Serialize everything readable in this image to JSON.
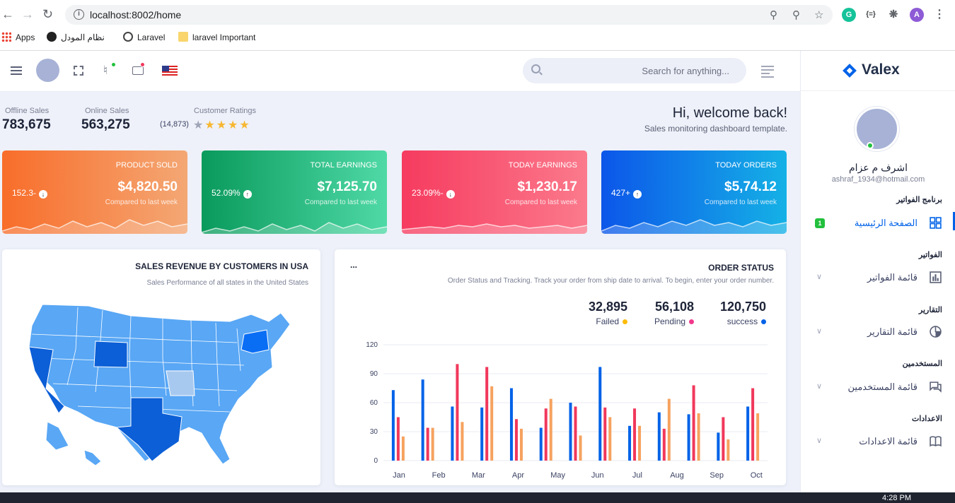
{
  "browser": {
    "url": "localhost:8002/home",
    "profile_initial": "A",
    "bookmarks": [
      {
        "label": "Apps"
      },
      {
        "label": "نظام المودل"
      },
      {
        "label": "Laravel"
      },
      {
        "label": "laravel Important"
      }
    ]
  },
  "header": {
    "search_placeholder": "Search for anything..."
  },
  "stats": {
    "offline_label": "Offline Sales",
    "offline_value": "783,675",
    "online_label": "Online Sales",
    "online_value": "563,275",
    "ratings_label": "Customer Ratings",
    "ratings_count": "(14,873)",
    "ratings_stars": 4.5
  },
  "welcome": {
    "title": "Hi, welcome back!",
    "subtitle": "Sales monitoring dashboard template."
  },
  "cards": [
    {
      "title": "PRODUCT SOLD",
      "amount": "$4,820.50",
      "compare": "Compared to last week",
      "percent": "152.3-",
      "trend": "down",
      "color_from": "#f86d2a",
      "color_to": "#f4a774"
    },
    {
      "title": "TOTAL EARNINGS",
      "amount": "$7,125.70",
      "compare": "Compared to last week",
      "percent": "52.09%",
      "trend": "up",
      "color_from": "#0a9a5c",
      "color_to": "#4fd9a6"
    },
    {
      "title": "TODAY EARNINGS",
      "amount": "$1,230.17",
      "compare": "Compared to last week",
      "percent": "23.09%-",
      "trend": "down",
      "color_from": "#f63b5f",
      "color_to": "#fb7a8c"
    },
    {
      "title": "TODAY ORDERS",
      "amount": "$5,74.12",
      "compare": "Compared to last week",
      "percent": "427+",
      "trend": "up",
      "color_from": "#0c56e9",
      "color_to": "#15b1e6"
    }
  ],
  "map_panel": {
    "title": "SALES REVENUE BY CUSTOMERS IN USA",
    "subtitle": "Sales Performance of all states in the United States"
  },
  "order_panel": {
    "title": "ORDER STATUS",
    "menu": "...",
    "subtitle": "Order Status and Tracking. Track your order from ship date to arrival. To begin, enter your order number.",
    "totals": [
      {
        "value": "32,895",
        "label": "Failed",
        "color": "#fbbc0b"
      },
      {
        "value": "56,108",
        "label": "Pending",
        "color": "#f1388b"
      },
      {
        "value": "120,750",
        "label": "success",
        "color": "#0162e8"
      }
    ]
  },
  "chart_data": {
    "type": "bar",
    "categories": [
      "Jan",
      "Feb",
      "Mar",
      "Apr",
      "May",
      "Jun",
      "Jul",
      "Aug",
      "Sep",
      "Oct"
    ],
    "series": [
      {
        "values": [
          73,
          84,
          56,
          55,
          75,
          34,
          60,
          97,
          36,
          50,
          48,
          29,
          56
        ],
        "color": "#0162e8"
      },
      {
        "values": [
          45,
          34,
          100,
          97,
          43,
          54,
          56,
          55,
          54,
          33,
          78,
          45,
          75
        ],
        "color": "#f1385c"
      },
      {
        "values": [
          25,
          34,
          40,
          77,
          33,
          64,
          26,
          45,
          36,
          64,
          49,
          22,
          49
        ],
        "color": "#f6a25f"
      }
    ],
    "yticks": [
      0,
      30,
      60,
      90,
      120
    ],
    "ylim": [
      0,
      120
    ]
  },
  "sidebar": {
    "brand": "Valex",
    "user_name": "اشرف م عزام",
    "user_email": "ashraf_1934@hotmail.com",
    "sections": [
      {
        "category": "برنامج الفواتير",
        "item": "الصفحة الرئيسية",
        "badge": "1",
        "active": true
      },
      {
        "category": "الفواتير",
        "item": "قائمة الفواتير"
      },
      {
        "category": "التقارير",
        "item": "قائمة التقارير"
      },
      {
        "category": "المستخدمين",
        "item": "قائمة المستخدمين"
      },
      {
        "category": "الاعدادات",
        "item": "قائمة الاعدادات"
      }
    ]
  },
  "taskbar": {
    "time": "4:28 PM"
  }
}
